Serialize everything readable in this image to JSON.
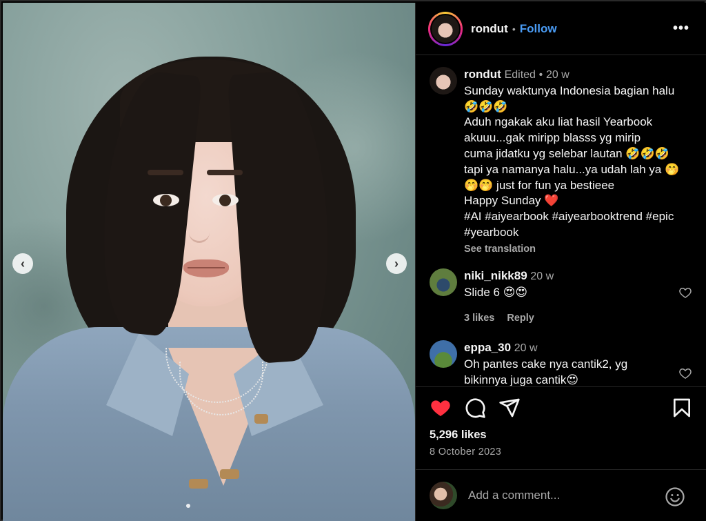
{
  "post": {
    "username": "rondut",
    "follow_label": "Follow",
    "separator": "•",
    "more_label": "•••",
    "nav_prev": "‹",
    "nav_next": "›"
  },
  "caption": {
    "username": "rondut",
    "edited": "Edited",
    "time": "20 w",
    "lines": [
      "Sunday waktunya Indonesia bagian halu",
      "🤣🤣🤣",
      "Aduh ngakak aku liat hasil Yearbook",
      "akuuu...gak miripp blasss yg mirip",
      "cuma jidatku yg selebar lautan 🤣🤣🤣",
      "tapi ya namanya halu...ya udah lah ya 🤭",
      "🤭🤭 just for fun ya bestieee",
      "Happy Sunday ❤️",
      "#AI #aiyearbook #aiyearbooktrend #epic",
      "#yearbook"
    ],
    "see_translation": "See translation"
  },
  "comments": [
    {
      "username": "niki_nikk89",
      "time": "20 w",
      "text": "Slide 6 😍😍",
      "likes": "3 likes",
      "reply": "Reply",
      "avatar_color": "#4a6b3a"
    },
    {
      "username": "eppa_30",
      "time": "20 w",
      "lines": [
        "Oh pantes cake nya cantik2, yg",
        "bikinnya juga cantik😍"
      ],
      "avatar_color": "#3f6fa8"
    }
  ],
  "actions": {
    "likes": "5,296 likes",
    "date": "8 October 2023",
    "like_color": "#ff3040",
    "icons": [
      "heart-icon",
      "comment-icon",
      "share-icon",
      "bookmark-icon"
    ]
  },
  "comment_box": {
    "placeholder": "Add a comment...",
    "emoji_icon": "smiley-icon"
  }
}
